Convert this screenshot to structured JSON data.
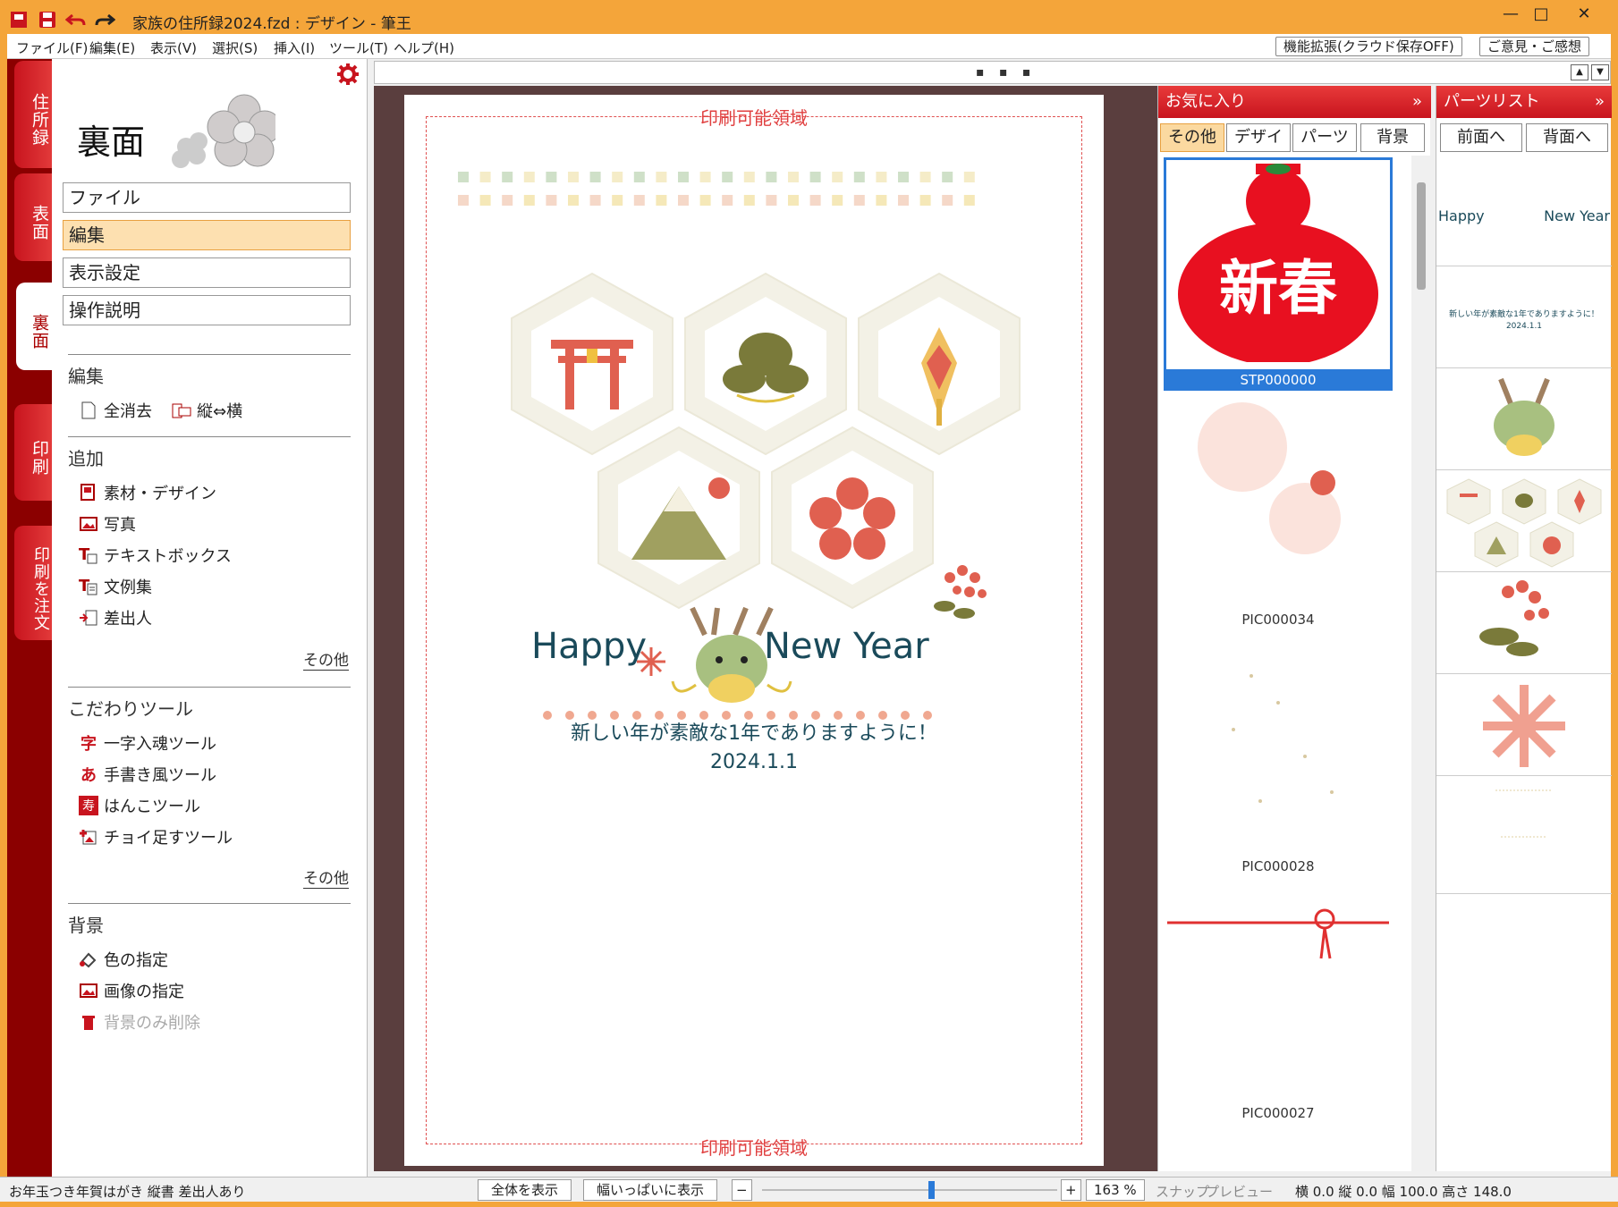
{
  "window": {
    "title": "家族の住所録2024.fzd : デザイン - 筆王",
    "minimize": "—",
    "maximize": "□",
    "close": "✕"
  },
  "menu": {
    "items": [
      "ファイル(F)",
      "編集(E)",
      "表示(V)",
      "選択(S)",
      "挿入(I)",
      "ツール(T)",
      "ヘルプ(H)"
    ],
    "ext_button": "機能拡張(クラウド保存OFF)",
    "feedback_button": "ご意見・ご感想"
  },
  "side_tabs": [
    "住所録",
    "表面",
    "裏面",
    "印刷",
    "印刷を注文"
  ],
  "left_panel": {
    "title": "裏面",
    "nav": [
      "ファイル",
      "編集",
      "表示設定",
      "操作説明"
    ],
    "sections": {
      "edit": {
        "title": "編集",
        "items": [
          "全消去",
          "縦⇔横"
        ]
      },
      "add": {
        "title": "追加",
        "items": [
          "素材・デザイン",
          "写真",
          "テキストボックス",
          "文例集",
          "差出人"
        ],
        "more": "その他"
      },
      "tools": {
        "title": "こだわりツール",
        "items": [
          "一字入魂ツール",
          "手書き風ツール",
          "はんこツール",
          "チョイ足すツール"
        ],
        "more": "その他"
      },
      "bg": {
        "title": "背景",
        "items": [
          "色の指定",
          "画像の指定",
          "背景のみ削除"
        ]
      }
    }
  },
  "canvas": {
    "print_label": "印刷可能領域",
    "greeting_left": "Happy",
    "greeting_right": "New Year",
    "message": "新しい年が素敵な1年でありますように！",
    "date": "2024.1.1",
    "dots": "▪ ▪ ▪"
  },
  "favorites": {
    "title": "お気に入り",
    "tabs": [
      "その他",
      "デザイン",
      "パーツ",
      "背景"
    ],
    "items": [
      {
        "label": "STP000000",
        "stamp_text": "新春"
      },
      {
        "label": "PIC000034"
      },
      {
        "label": "PIC000028"
      },
      {
        "label": "PIC000027"
      }
    ]
  },
  "parts_list": {
    "title": "パーツリスト",
    "front_button": "前面へ",
    "back_button": "背面へ",
    "item_happy": "Happy",
    "item_newyear": "New Year",
    "item_message": "新しい年が素敵な1年でありますように！",
    "item_date": "2024.1.1"
  },
  "status": {
    "left": "お年玉つき年賀はがき 縦書 差出人あり",
    "fit_all": "全体を表示",
    "fit_width": "幅いっぱいに表示",
    "zoom": "163 %",
    "snap": "スナップ",
    "preview": "プレビュー",
    "coords": "横 0.0 縦 0.0 幅 100.0 高さ 148.0"
  },
  "colors": {
    "accent": "#c8141e",
    "title_bg": "#f4a53a",
    "selected": "#fde0b0"
  }
}
